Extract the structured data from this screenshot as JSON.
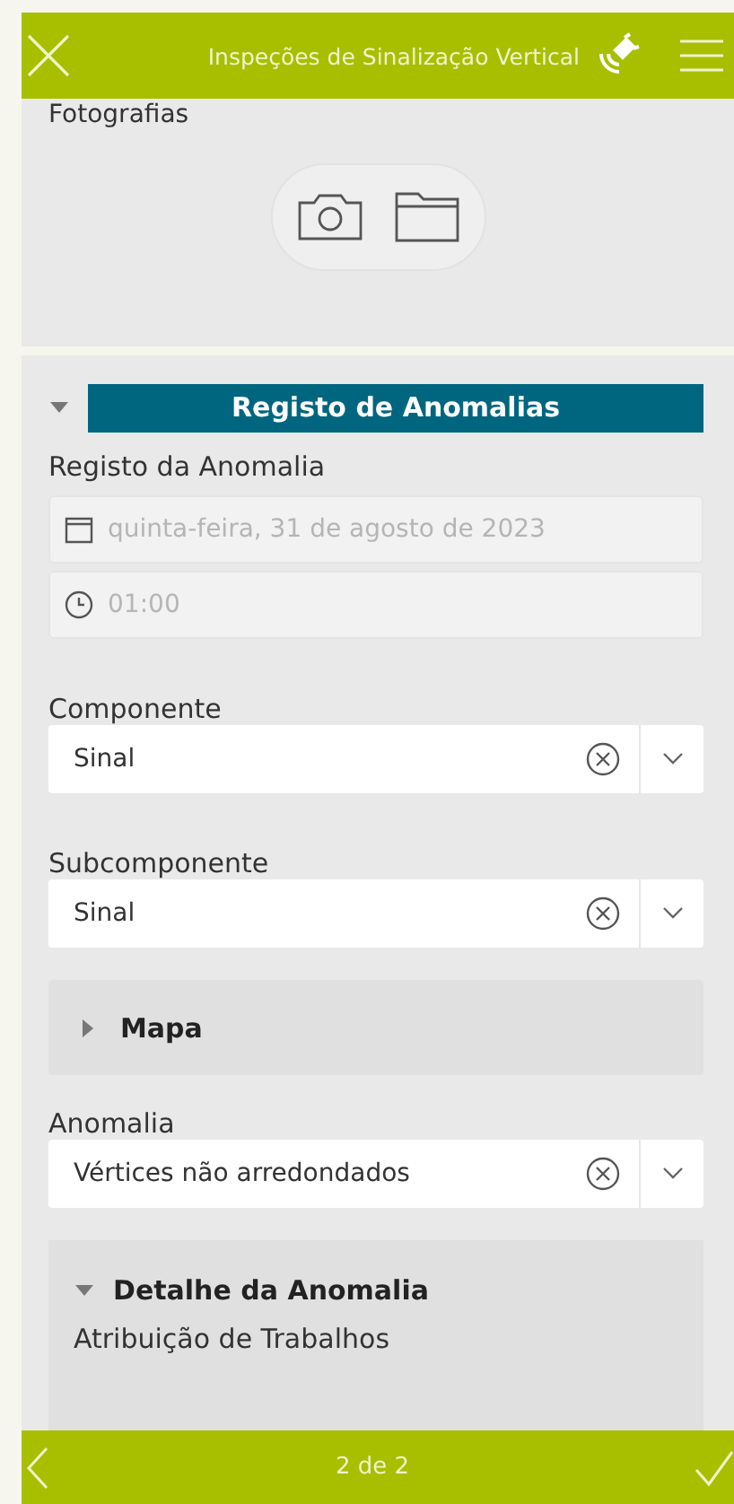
{
  "header": {
    "title": "Inspeções de Sinalização Vertical"
  },
  "photos": {
    "label": "Fotografias"
  },
  "section": {
    "title": "Registo de Anomalias",
    "expanded": true
  },
  "record": {
    "label": "Registo da Anomalia",
    "date": "quinta-feira, 31 de agosto de 2023",
    "time": "01:00"
  },
  "fields_before_map": [
    {
      "label": "Componente",
      "value": "Sinal"
    },
    {
      "label": "Subcomponente",
      "value": "Sinal"
    }
  ],
  "map": {
    "title": "Mapa",
    "expanded": false
  },
  "fields_after_map": [
    {
      "label": "Anomalia",
      "value": "Vértices não arredondados"
    }
  ],
  "detail": {
    "title": "Detalhe da Anomalia",
    "expanded": true,
    "first_label": "Atribuição de Trabalhos"
  },
  "footer": {
    "page": "2 de 2"
  }
}
